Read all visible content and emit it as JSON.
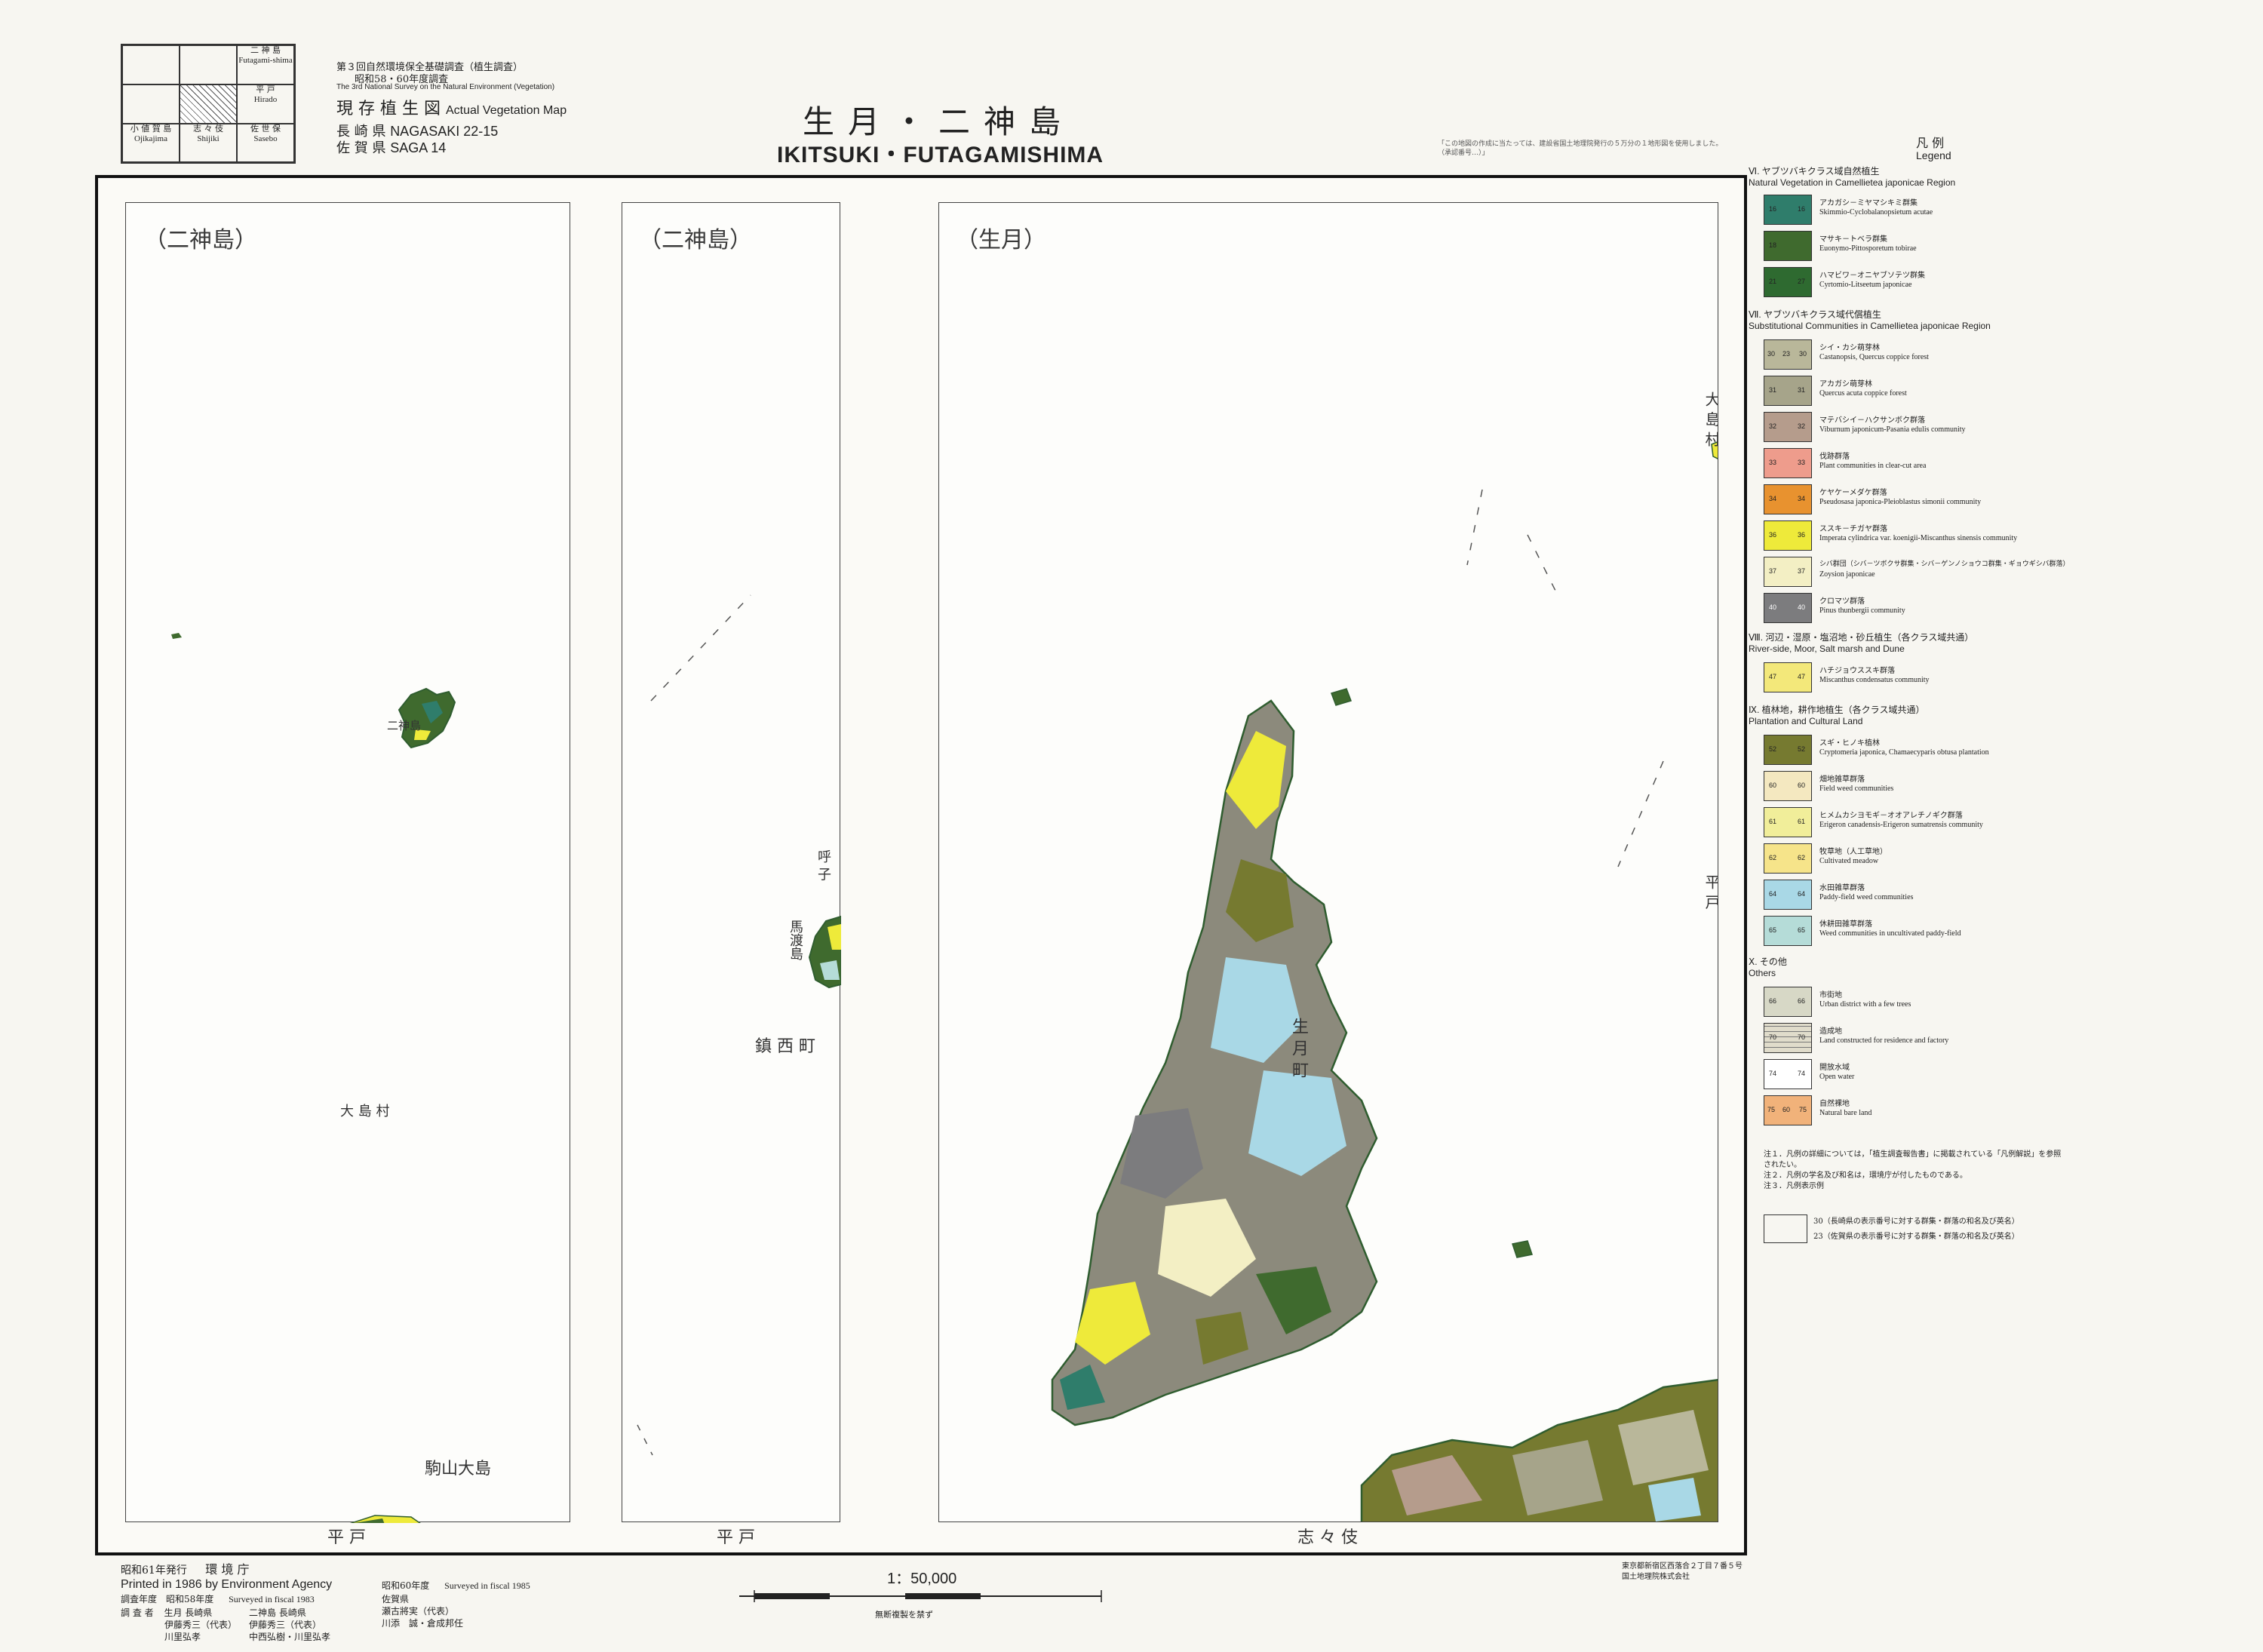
{
  "index_map": {
    "cells": [
      {
        "jp": "",
        "en": ""
      },
      {
        "jp": "",
        "en": ""
      },
      {
        "jp": "二 神 島",
        "en": "Futagami-shima"
      },
      {
        "jp": "",
        "en": ""
      },
      {
        "jp": "",
        "en": ""
      },
      {
        "jp": "平 戸",
        "en": "Hirado"
      },
      {
        "jp": "小 値 賀 島",
        "en": "Ojikajima"
      },
      {
        "jp": "志 々 伎",
        "en": "Shijiki"
      },
      {
        "jp": "佐 世 保",
        "en": "Sasebo"
      }
    ]
  },
  "header": {
    "survey_jp": "第３回自然環境保全基礎調査（植生調査）",
    "survey_years": "昭和58・60年度調査",
    "survey_en": "The 3rd National Survey on the Natural Environment (Vegetation)",
    "map_type_jp": "現 存 植 生 図",
    "map_type_en": "Actual Vegetation Map",
    "pref1_jp": "長 崎 県",
    "pref1_en": "NAGASAKI 22-15",
    "pref2_jp": "佐 賀 県",
    "pref2_en": "SAGA 14",
    "title_jp": "生月・二神島",
    "title_en": "IKITSUKI・FUTAGAMISHIMA",
    "note": "「この地図の作成に当たっては、建設省国土地理院発行の５万分の１地形図を使用しました。（承認番号…）」"
  },
  "panels": {
    "left_label": "（二神島）",
    "middle_label": "（二神島）",
    "right_label": "（生月）"
  },
  "places": {
    "futagamishima": "二神島",
    "oshima_village": "大 島 村",
    "hirado_left": "平 戸",
    "komoyama_oshima": "駒山大島",
    "madarashima": "馬渡島",
    "chinzei_town": "鎮 西 町",
    "yobuko": "呼 子",
    "hirado_mid": "平 戸",
    "ikitsuki_town": "生 月 町",
    "oshima_village_right": "大 島 村",
    "hirado_right": "平 戸",
    "shijiki": "志 々 伎"
  },
  "legend": {
    "title_jp": "凡 例",
    "title_en": "Legend",
    "sections": [
      {
        "head_jp": "Ⅵ. ヤブツバキクラス域自然植生",
        "head_en": "Natural Vegetation in Camellietea japonicae Region",
        "items": [
          {
            "codes": [
              "16",
              "16"
            ],
            "color": "#2f7d6b",
            "jp": "アカガシ－ミヤマシキミ群集",
            "en": "Skimmio-Cyclobalanopsietum acutae"
          },
          {
            "codes": [
              "18",
              ""
            ],
            "color": "#3f6a2e",
            "jp": "マサキ－トベラ群集",
            "en": "Euonymo-Pittosporetum tobirae"
          },
          {
            "codes": [
              "21",
              "27"
            ],
            "color": "#2e6a30",
            "jp": "ハマビワ－オニヤブソテツ群集",
            "en": "Cyrtomio-Litseetum japonicae"
          }
        ]
      },
      {
        "head_jp": "Ⅶ. ヤブツバキクラス域代償植生",
        "head_en": "Substitutional Communities in Camellietea japonicae Region",
        "items": [
          {
            "codes": [
              "30",
              "23",
              "30"
            ],
            "color": "#b9b79a",
            "jp": "シイ・カシ萌芽林",
            "en": "Castanopsis, Quercus coppice forest"
          },
          {
            "codes": [
              "31",
              "31"
            ],
            "color": "#a6a48a",
            "jp": "アカガシ萌芽林",
            "en": "Quercus acuta coppice forest"
          },
          {
            "codes": [
              "32",
              "32"
            ],
            "color": "#b59c8c",
            "jp": "マテバシイ－ハクサンボク群落",
            "en": "Viburnum japonicum-Pasania edulis community"
          },
          {
            "codes": [
              "33",
              "33"
            ],
            "color": "#ee9c8c",
            "jp": "伐跡群落",
            "en": "Plant communities in clear-cut area"
          },
          {
            "codes": [
              "34",
              "34"
            ],
            "color": "#e8922f",
            "jp": "ケヤケーメダケ群落",
            "en": "Pseudosasa japonica-Pleioblastus simonii community"
          },
          {
            "codes": [
              "36",
              "36"
            ],
            "color": "#eeea3a",
            "jp": "ススキ－チガヤ群落",
            "en": "Imperata cylindrica var. koenigii-Miscanthus sinensis community"
          },
          {
            "codes": [
              "37",
              "37"
            ],
            "color": "#f3efc4",
            "jp": "シバ群団（シバ－ツボクサ群集・シバ－ゲンノショウコ群集・ギョウギシバ群落）",
            "en": "Zoysion japonicae"
          },
          {
            "codes": [
              "40",
              "40"
            ],
            "color": "#7c7c7e",
            "jp": "クロマツ群落",
            "en": "Pinus thunbergii community"
          }
        ]
      },
      {
        "head_jp": "Ⅷ. 河辺・湿原・塩沼地・砂丘植生（各クラス域共通）",
        "head_en": "River-side, Moor, Salt marsh and Dune",
        "items": [
          {
            "codes": [
              "47",
              "47"
            ],
            "color": "#f3e87a",
            "jp": "ハチジョウススキ群落",
            "en": "Miscanthus condensatus community"
          }
        ]
      },
      {
        "head_jp": "Ⅸ. 植林地，耕作地植生（各クラス域共通）",
        "head_en": "Plantation and Cultural Land",
        "items": [
          {
            "codes": [
              "52",
              "52"
            ],
            "color": "#767a30",
            "jp": "スギ・ヒノキ植林",
            "en": "Cryptomeria japonica, Chamaecyparis obtusa plantation"
          },
          {
            "codes": [
              "60",
              "60"
            ],
            "color": "#f4e8c0",
            "jp": "畑地雑草群落",
            "en": "Field weed communities"
          },
          {
            "codes": [
              "61",
              "61"
            ],
            "color": "#f1ee9a",
            "jp": "ヒメムカシヨモギ－オオアレチノギク群落",
            "en": "Erigeron canadensis-Erigeron sumatrensis community"
          },
          {
            "codes": [
              "62",
              "62"
            ],
            "color": "#f6e48a",
            "jp": "牧草地（人工草地）",
            "en": "Cultivated meadow"
          },
          {
            "codes": [
              "64",
              "64"
            ],
            "color": "#a9d8e6",
            "jp": "水田雑草群落",
            "en": "Paddy-field weed communities"
          },
          {
            "codes": [
              "65",
              "65"
            ],
            "color": "#b5dcd8",
            "jp": "休耕田雑草群落",
            "en": "Weed communities in uncultivated paddy-field"
          }
        ]
      },
      {
        "head_jp": "Ⅹ. その他",
        "head_en": "Others",
        "items": [
          {
            "codes": [
              "66",
              "66"
            ],
            "color": "#d7d8c6",
            "jp": "市街地",
            "en": "Urban district with a few trees"
          },
          {
            "codes": [
              "70",
              "70"
            ],
            "color": "#e0dccb",
            "jp": "造成地",
            "en": "Land constructed for residence and factory"
          },
          {
            "codes": [
              "74",
              "74"
            ],
            "color": "#ffffff",
            "jp": "開放水域",
            "en": "Open water"
          },
          {
            "codes": [
              "75",
              "60",
              "75"
            ],
            "color": "#f1b27a",
            "jp": "自然裸地",
            "en": "Natural bare land"
          }
        ]
      }
    ],
    "notes": [
      "注１．凡例の詳細については，「植生調査報告書」に掲載されている「凡例解説」を参照されたい。",
      "注２．凡例の学名及び和名は，環境庁が付したものである。",
      "注３．凡例表示例"
    ],
    "example_nagasaki": "30（長崎県の表示番号に対する群集・群落の和名及び英名）",
    "example_saga": "23（佐賀県の表示番号に対する群集・群落の和名及び英名）"
  },
  "footer": {
    "published_jp": "昭和61年発行",
    "agency_jp": "環 境 庁",
    "printed_en": "Printed in 1986 by Environment Agency",
    "survey_year_jp": "調査年度　昭和58年度",
    "surveyed_en1": "Surveyed in fiscal 1983",
    "survey_year_jp2": "昭和60年度",
    "surveyed_en2": "Surveyed in fiscal 1985",
    "surveyor_label": "調 査 者",
    "surveyor_line1": "生月 長崎県",
    "surveyor_line2": "伊藤秀三（代表）",
    "surveyor_line3": "川里弘孝",
    "futagami_line1": "二神島 長崎県",
    "futagami_line2": "伊藤秀三（代表）",
    "futagami_line3": "中西弘樹・川里弘孝",
    "saga_line1": "佐賀県",
    "saga_line2": "瀬古將実（代表）",
    "saga_line3": "川添　誠・倉成邦任",
    "scale": "1：50,000",
    "scale_note": "無断複製を禁ず",
    "printer_line1": "東京都新宿区西落合２丁目７番５号",
    "printer_line2": "国土地理院株式会社"
  },
  "colors": {
    "frame": "#111111",
    "coastline": "#2f5d2f",
    "water_label": "#4a7a4a"
  }
}
